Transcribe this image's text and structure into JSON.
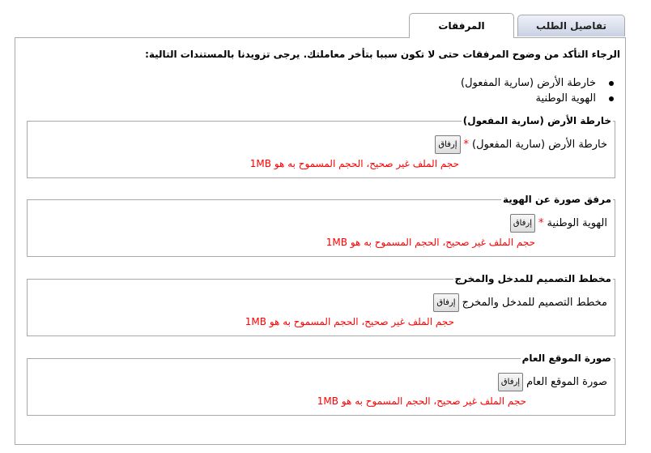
{
  "tabs": {
    "attachments": "المرفقات",
    "request_details": "تفاصيل الطلب"
  },
  "intro": "الرجاء التأكد من وضوح المرفقات حتى لا تكون سببا بتأخر معاملتك. يرجى تزويدنا بالمستندات التالية:",
  "required_docs": [
    "خارطة الأرض (سارية المفعول)",
    "الهوية الوطنية"
  ],
  "sections": [
    {
      "legend": "خارطة الأرض (سارية المفعول)",
      "label": "خارطة الأرض (سارية المفعول)",
      "required_mark": "*",
      "button": "إرفاق",
      "error": "حجم الملف غير صحيح، الحجم المسموح به هو 1MB"
    },
    {
      "legend": "مرفق صورة عن الهوية",
      "label": "الهوية الوطنية",
      "required_mark": "*",
      "button": "إرفاق",
      "error": "حجم الملف غير صحيح، الحجم المسموح به هو 1MB"
    },
    {
      "legend": "مخطط التصميم للمدخل والمخرج",
      "label": "مخطط التصميم للمدخل والمخرج",
      "button": "إرفاق",
      "error": "حجم الملف غير صحيح، الحجم المسموح به هو 1MB"
    },
    {
      "legend": "صورة الموقع العام",
      "label": "صورة الموقع العام",
      "button": "إرفاق",
      "error": "حجم الملف غير صحيح، الحجم المسموح به هو 1MB"
    }
  ],
  "colors": {
    "error": "#ff0000",
    "border": "#a9a9a9",
    "inactive_tab_top": "#eef1f8",
    "inactive_tab_bottom": "#c9d1e4"
  }
}
